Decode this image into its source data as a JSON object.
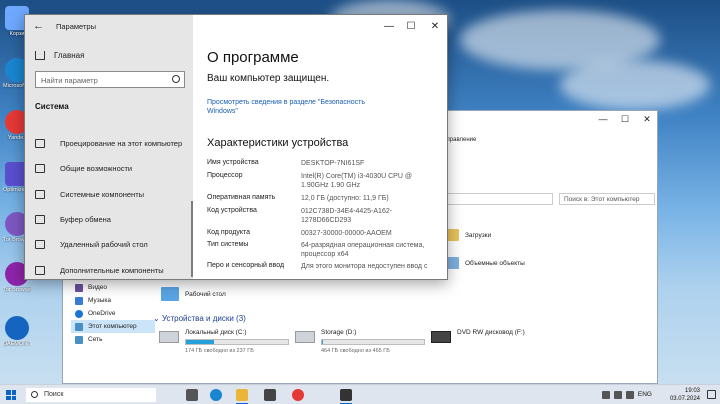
{
  "desktop": {
    "icons": [
      {
        "label": "Корзи",
        "color": "#6ea8ff"
      },
      {
        "label": "Microsoft Edge",
        "color": "#1a86d1"
      },
      {
        "label": "Yandex",
        "color": "#e53935"
      },
      {
        "label": "Optimizer Utility",
        "color": "#5a4fcf"
      },
      {
        "label": "Tor Browser",
        "color": "#7e57c2"
      },
      {
        "label": "Tor Browser",
        "color": "#8e24aa"
      },
      {
        "label": "DAEMON Tools Lite",
        "color": "#1565c0"
      }
    ]
  },
  "explorer": {
    "ribbon_text": "Управление",
    "search_placeholder": "Поиск в: Этот компьютер",
    "nav": [
      {
        "label": "Видео",
        "icon": "video-icon",
        "color": "#6b4fa0"
      },
      {
        "label": "Музыка",
        "icon": "music-icon",
        "color": "#3a7bd5"
      },
      {
        "label": "OneDrive",
        "icon": "cloud-icon",
        "color": "#1976d2"
      },
      {
        "label": "Этот компьютер",
        "icon": "computer-icon",
        "color": "#4a90c8"
      },
      {
        "label": "Сеть",
        "icon": "network-icon",
        "color": "#4a90c8"
      }
    ],
    "folders": {
      "downloads": "Загрузки",
      "objects3d": "Объемные объекты",
      "desktop": "Рабочий стол"
    },
    "drives_group": "Устройства и диски (3)",
    "drives": [
      {
        "name": "Локальный диск (C:)",
        "free": "174 ГБ свободно из 237 ГБ",
        "used_fraction": 0.27
      },
      {
        "name": "Storage (D:)",
        "free": "464 ГБ свободно из 465 ГБ",
        "used_fraction": 0.01
      },
      {
        "name": "DVD RW дисковод (F:)",
        "free": "",
        "used_fraction": null
      }
    ]
  },
  "settings": {
    "window_title": "Параметры",
    "home": "Главная",
    "search_placeholder": "Найти параметр",
    "section": "Система",
    "menu": [
      {
        "label": "Проецирование на этот компьютер",
        "icon": "projector-icon"
      },
      {
        "label": "Общие возможности",
        "icon": "shared-icon"
      },
      {
        "label": "Системные компоненты",
        "icon": "components-icon"
      },
      {
        "label": "Буфер обмена",
        "icon": "clipboard-icon"
      },
      {
        "label": "Удаленный рабочий стол",
        "icon": "remote-desktop-icon"
      },
      {
        "label": "Дополнительные компоненты",
        "icon": "extra-components-icon"
      }
    ],
    "page_title": "О программе",
    "protected": "Ваш компьютер защищен.",
    "security_link": "Просмотреть сведения в разделе \"Безопасность Windows\"",
    "specs_title": "Характеристики устройства",
    "specs": [
      {
        "key": "Имя устройства",
        "value": "DESKTOP-7NI61SF"
      },
      {
        "key": "Процессор",
        "value": "Intel(R) Core(TM) i3-4030U CPU @ 1.90GHz   1.90 GHz"
      },
      {
        "key": "Оперативная память",
        "value": "12,0 ГБ (доступно: 11,9 ГБ)"
      },
      {
        "key": "Код устройства",
        "value": "012C738D-34E4-4425-A162-1278D66CD293"
      },
      {
        "key": "Код продукта",
        "value": "00327-30000-00000-AAOEM"
      },
      {
        "key": "Тип системы",
        "value": "64-разрядная операционная система, процессор x64"
      },
      {
        "key": "Перо и сенсорный ввод",
        "value": "Для этого монитора недоступен ввод с"
      }
    ]
  },
  "taskbar": {
    "search": "Поиск",
    "apps": [
      {
        "name": "task-view",
        "color": "#555555"
      },
      {
        "name": "edge",
        "color": "#1a86d1"
      },
      {
        "name": "file-explorer",
        "color": "#e9b53a"
      },
      {
        "name": "store",
        "color": "#444444"
      },
      {
        "name": "yandex",
        "color": "#e53935"
      },
      {
        "name": "settings",
        "color": "#333333"
      }
    ],
    "lang": "ENG",
    "time": "19:03",
    "date": "03.07.2024"
  }
}
